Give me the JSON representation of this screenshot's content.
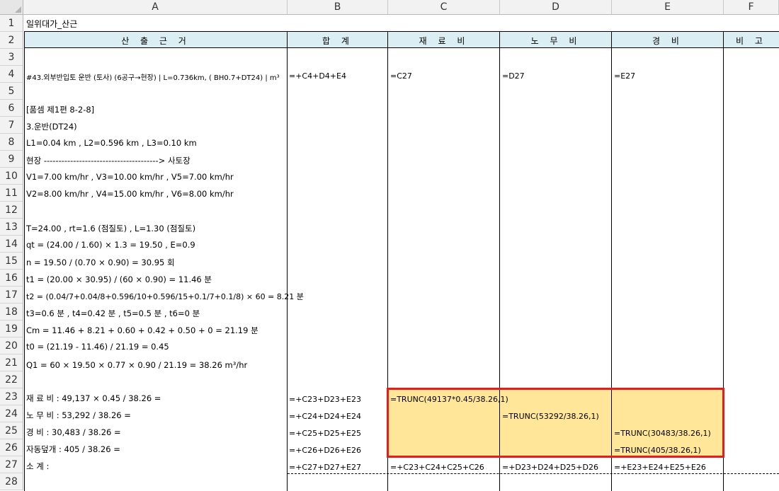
{
  "columns": [
    "A",
    "B",
    "C",
    "D",
    "E",
    "F"
  ],
  "rows": [
    "1",
    "2",
    "3",
    "4",
    "5",
    "6",
    "7",
    "8",
    "9",
    "10",
    "11",
    "12",
    "13",
    "14",
    "15",
    "16",
    "17",
    "18",
    "19",
    "20",
    "21",
    "22",
    "23",
    "24",
    "25",
    "26",
    "27",
    "28"
  ],
  "sheet_title": "일위대가_산근",
  "headers": {
    "basis": "산 출 근 거",
    "total": "합 계",
    "material": "재 료 비",
    "labor": "노 무 비",
    "expense": "경 비",
    "note": "비 고"
  },
  "row4": {
    "a": "#43.외부반입토 운반 (토사) (6공구→현장) | L=0.736km, ( BH0.7+DT24) | m³",
    "b": "=+C4+D4+E4",
    "c": "=C27",
    "d": "=D27",
    "e": "=E27"
  },
  "calc_lines": {
    "r6": " [품셈 제1편 8-2-8]",
    "r7": " 3.운반(DT24)",
    "r8": "   L1=0.04 km  ,  L2=0.596 km  ,   L3=0.10 km",
    "r9": "   현장 ---------------------------------------> 사토장",
    "r10": "   V1=7.00 km/hr  , V3=10.00 km/hr  , V5=7.00 km/hr",
    "r11": "   V2=8.00 km/hr  , V4=15.00 km/hr  , V6=8.00 km/hr",
    "r13": "   T=24.00 , rt=1.6 (점질토)  , L=1.30 (점질토)",
    "r14": "   qt = (24.00 / 1.60) × 1.3 = 19.50 , E=0.9",
    "r15": "   n = 19.50 / (0.70 × 0.90) = 30.95 회",
    "r16": "   t1 = (20.00 × 30.95) / (60 × 0.90) = 11.46 분",
    "r17": "   t2 = (0.04/7+0.04/8+0.596/10+0.596/15+0.1/7+0.1/8) × 60 = 8.21 분",
    "r18": "   t3=0.6 분 , t4=0.42 분  , t5=0.5 분  , t6=0 분",
    "r19": "   Cm = 11.46 + 8.21 + 0.60 + 0.42 + 0.50 + 0 = 21.19 분",
    "r20": "   t0 = (21.19 - 11.46) / 21.19 = 0.45",
    "r21": "   Q1 = 60 × 19.50 × 0.77 × 0.90 / 21.19 = 38.26 m³/hr"
  },
  "cost_rows": {
    "r23": {
      "a": "   재 료 비 :  49,137 × 0.45 / 38.26 =",
      "b": "=+C23+D23+E23",
      "c": "=TRUNC(49137*0.45/38.26,1)",
      "d": "",
      "e": ""
    },
    "r24": {
      "a": "   노 무 비 :  53,292 / 38.26 =",
      "b": "=+C24+D24+E24",
      "c": "",
      "d": "=TRUNC(53292/38.26,1)",
      "e": ""
    },
    "r25": {
      "a": "   경     비 :  30,483 / 38.26 =",
      "b": "=+C25+D25+E25",
      "c": "",
      "d": "",
      "e": "=TRUNC(30483/38.26,1)"
    },
    "r26": {
      "a": "   자동덮개 :  405 / 38.26 =",
      "b": "=+C26+D26+E26",
      "c": "",
      "d": "",
      "e": "=TRUNC(405/38.26,1)"
    },
    "r27": {
      "a": "   소     계 :",
      "b": "=+C27+D27+E27",
      "c": "=+C23+C24+C25+C26",
      "d": "=+D23+D24+D25+D26",
      "e": "=+E23+E24+E25+E26"
    }
  },
  "colors": {
    "header_band": "#daeef3",
    "highlight_fill": "#ffe699",
    "highlight_border": "#e02020",
    "grid_header_bg": "#f2f2f2"
  }
}
